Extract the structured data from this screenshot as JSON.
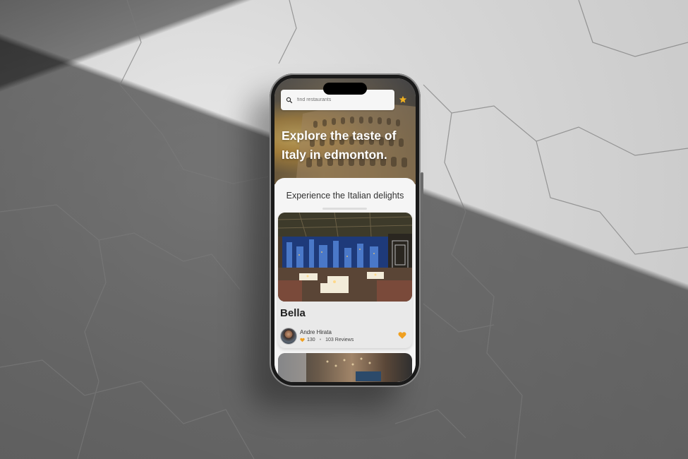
{
  "search": {
    "placeholder": "find restaurants"
  },
  "hero": {
    "title": "Explore the taste of Italy in edmonton."
  },
  "sheet": {
    "title": "Experience the Italian delights"
  },
  "cards": [
    {
      "name": "Bella",
      "author": "Andre Hirata",
      "likes": "130",
      "reviews": "103 Reviews"
    }
  ],
  "colors": {
    "accent": "#f0a020",
    "hero_text": "#ffffff",
    "sheet_bg": "#f5f5f5"
  },
  "icons": {
    "search": "search-icon",
    "favorite": "star-icon",
    "like": "heart-icon"
  }
}
